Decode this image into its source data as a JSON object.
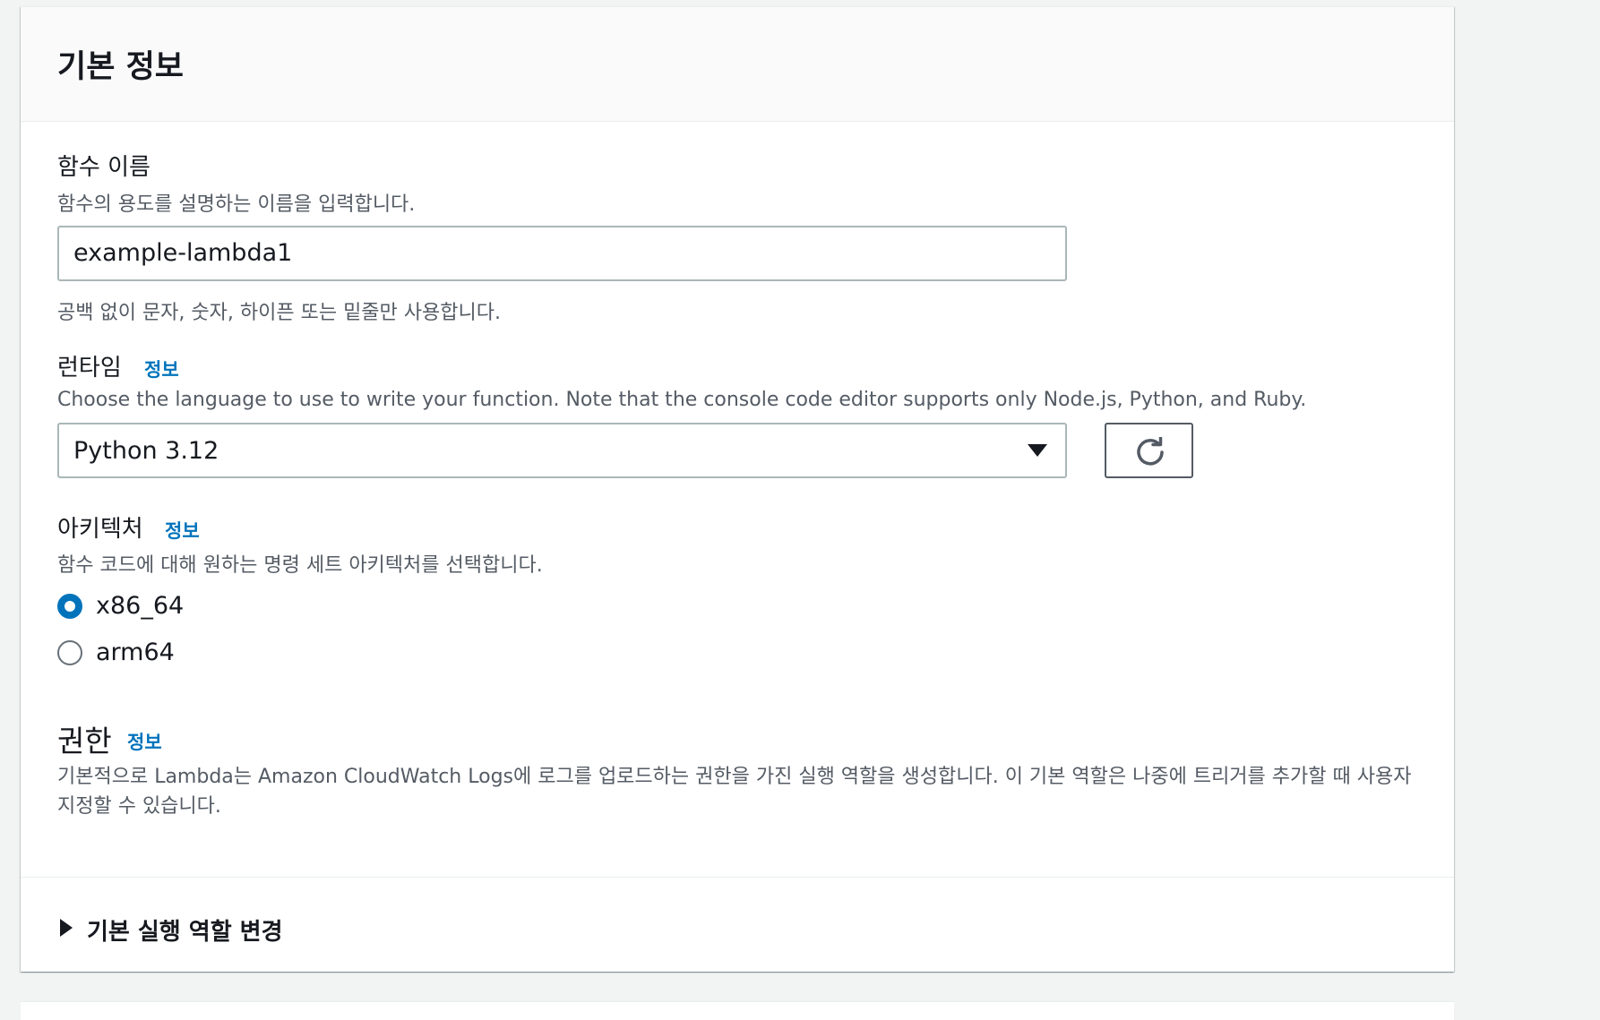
{
  "panel": {
    "title": "기본 정보"
  },
  "function_name": {
    "label": "함수 이름",
    "description": "함수의 용도를 설명하는 이름을 입력합니다.",
    "value": "example-lambda1",
    "constraint": "공백 없이 문자, 숫자, 하이픈 또는 밑줄만 사용합니다."
  },
  "runtime": {
    "label": "런타임",
    "info_link": "정보",
    "description": "Choose the language to use to write your function. Note that the console code editor supports only Node.js, Python, and Ruby.",
    "selected": "Python 3.12",
    "refresh_icon": "refresh-icon"
  },
  "architecture": {
    "label": "아키텍처",
    "info_link": "정보",
    "description": "함수 코드에 대해 원하는 명령 세트 아키텍처를 선택합니다.",
    "options": [
      {
        "label": "x86_64",
        "checked": true
      },
      {
        "label": "arm64",
        "checked": false
      }
    ]
  },
  "permissions": {
    "heading": "권한",
    "info_link": "정보",
    "text": "기본적으로 Lambda는 Amazon CloudWatch Logs에 로그를 업로드하는 권한을 가진 실행 역할을 생성합니다. 이 기본 역할은 나중에 트리거를 추가할 때 사용자 지정할 수 있습니다.",
    "expander_label": "기본 실행 역할 변경"
  },
  "colors": {
    "link": "#0073bb",
    "radio_selected": "#0073bb",
    "text_primary": "#16191f",
    "text_secondary": "#545b64"
  }
}
